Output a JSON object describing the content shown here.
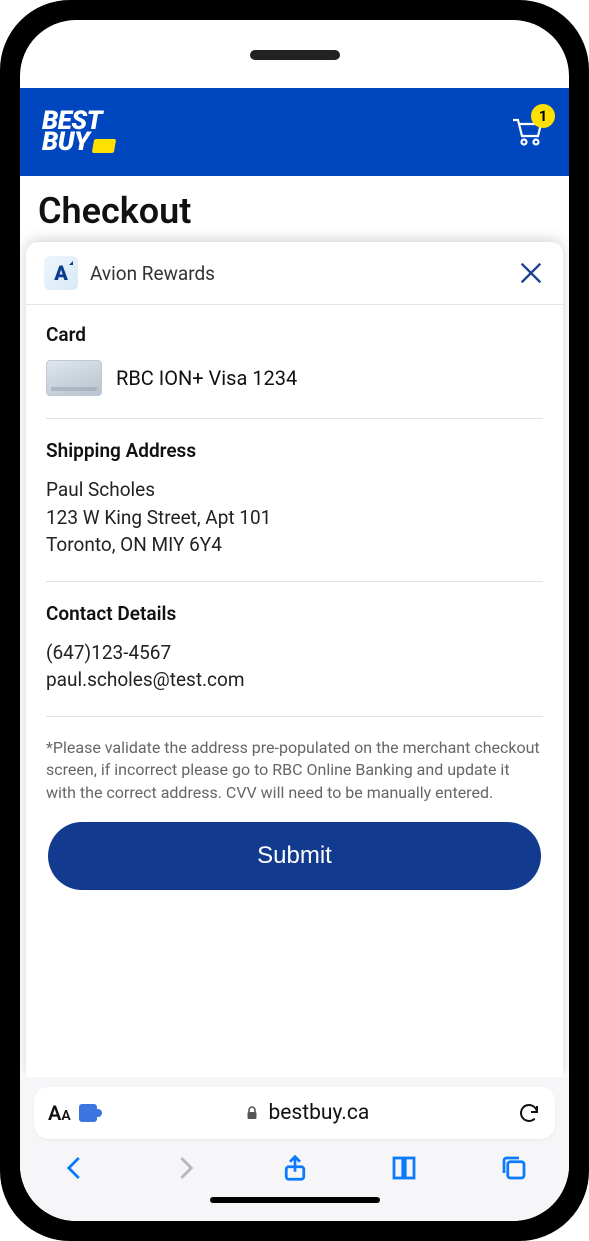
{
  "store": {
    "logo_line1": "BEST",
    "logo_line2": "BUY",
    "cart_count": "1"
  },
  "page": {
    "title": "Checkout"
  },
  "sheet": {
    "app_name": "Avion Rewards",
    "avion_letter": "A",
    "card_label": "Card",
    "card_name": "RBC ION+ Visa 1234",
    "shipping_label": "Shipping Address",
    "shipping_name": "Paul Scholes",
    "shipping_line1": "123 W King Street, Apt 101",
    "shipping_line2": "Toronto, ON MIY 6Y4",
    "contact_label": "Contact Details",
    "contact_phone": "(647)123-4567",
    "contact_email": "paul.scholes@test.com",
    "disclaimer": "*Please validate the address pre-populated on the merchant checkout screen, if incorrect please go to RBC Online Banking and update it with the correct address. CVV will need to be manually entered.",
    "submit_label": "Submit"
  },
  "browser": {
    "domain": "bestbuy.ca"
  }
}
